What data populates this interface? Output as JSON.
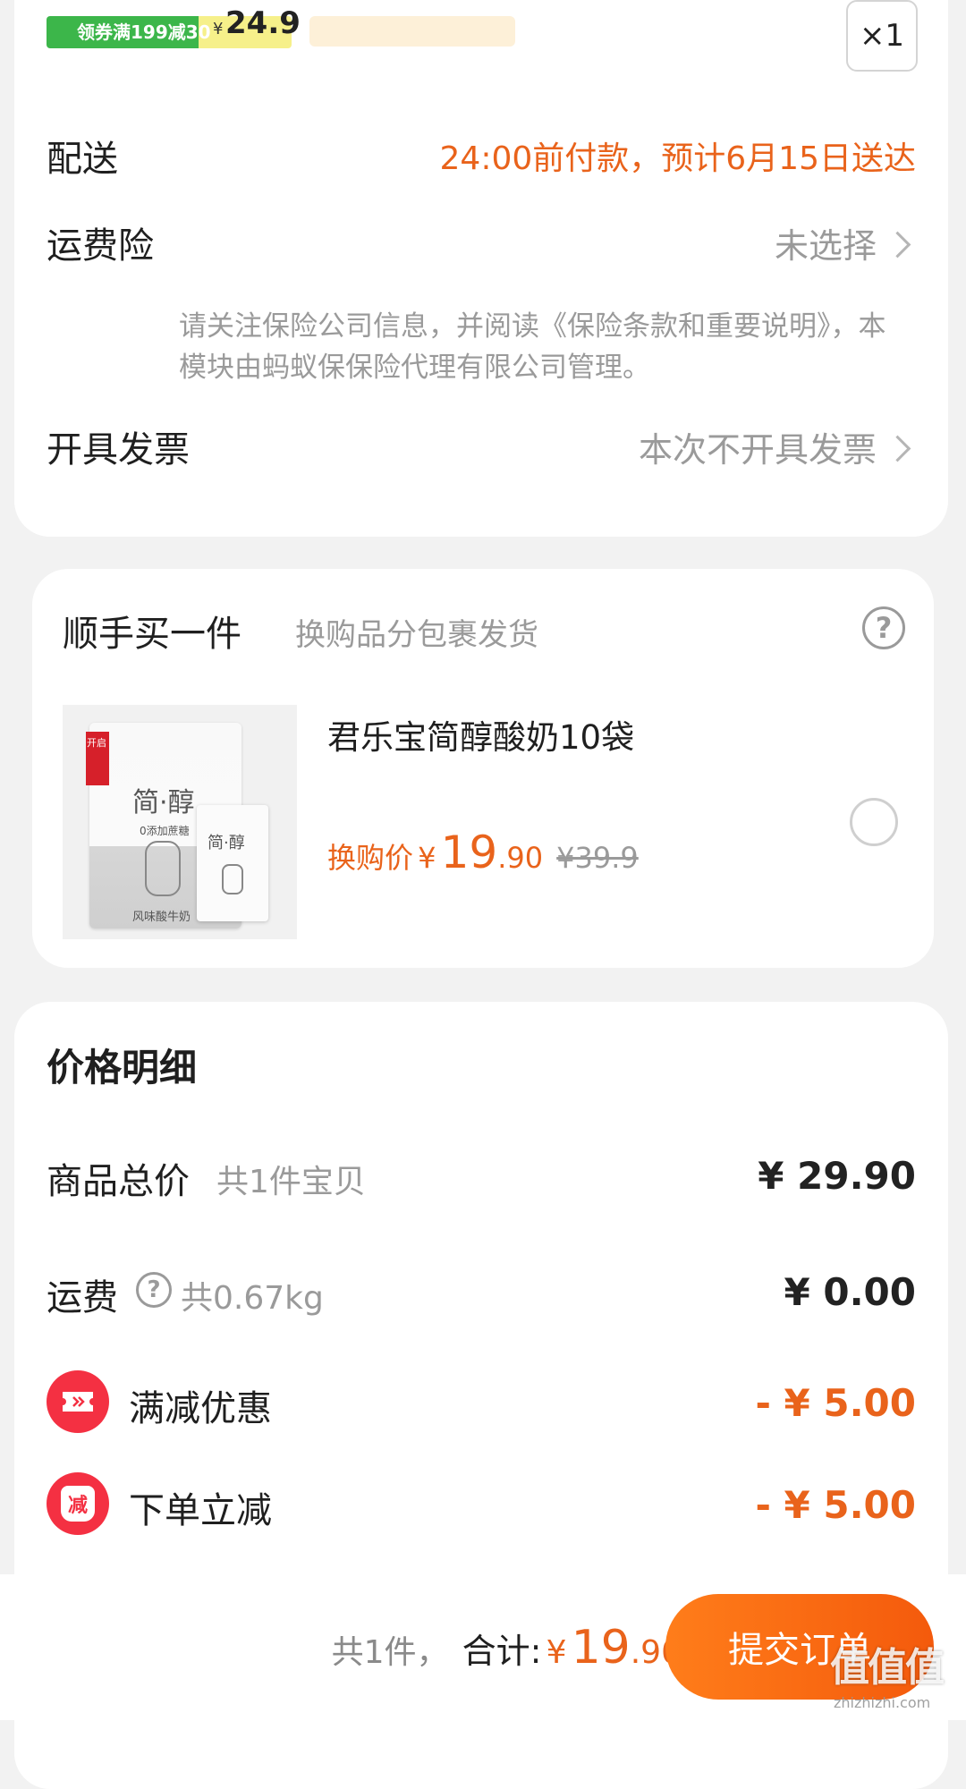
{
  "top": {
    "coupon_label": "领券满199减30",
    "coupon_price": "24.9",
    "coupon_currency": "¥",
    "qty": "×1"
  },
  "order": {
    "delivery_label": "配送",
    "delivery_value": "24:00前付款，预计6月15日送达",
    "insurance_label": "运费险",
    "insurance_value": "未选择",
    "insurance_note": "请关注保险公司信息，并阅读《保险条款和重要说明》，本模块由蚂蚁保保险代理有限公司管理。",
    "invoice_label": "开具发票",
    "invoice_value": "本次不开具发票"
  },
  "addon": {
    "title": "顺手买一件",
    "subtitle": "换购品分包裹发货",
    "help_glyph": "?",
    "product_name": "君乐宝简醇酸奶10袋",
    "price_label": "换购价",
    "currency": "¥",
    "price_int": "19",
    "price_dec": ".90",
    "original_price": "¥39.9",
    "image_texts": {
      "tag": "开启",
      "brand_big": "简·醇",
      "slogan": "0添加蔗糖",
      "product_type": "风味酸牛奶",
      "brand_small": "简·醇"
    }
  },
  "price_detail": {
    "title": "价格明细",
    "rows": [
      {
        "label": "商品总价",
        "sub": "共1件宝贝",
        "value": "¥ 29.90"
      },
      {
        "label": "运费",
        "sub": "共0.67kg",
        "value": "¥ 0.00"
      },
      {
        "label": "满减优惠",
        "value": "- ¥ 5.00",
        "badge": "ticket-icon"
      },
      {
        "label": "下单立减",
        "value": "- ¥ 5.00",
        "badge_text": "减"
      }
    ]
  },
  "footer": {
    "count": "共1件，",
    "total_label": "合计:",
    "currency": "¥",
    "total_int": "19",
    "total_dec": ".90",
    "submit": "提交订单"
  },
  "watermark": {
    "text": "值值值",
    "url": "zhizhizhi.com"
  },
  "colors": {
    "accent": "#e9631b",
    "button_start": "#ff7d1a",
    "button_end": "#f45a0c",
    "badge_red": "#f43042"
  }
}
